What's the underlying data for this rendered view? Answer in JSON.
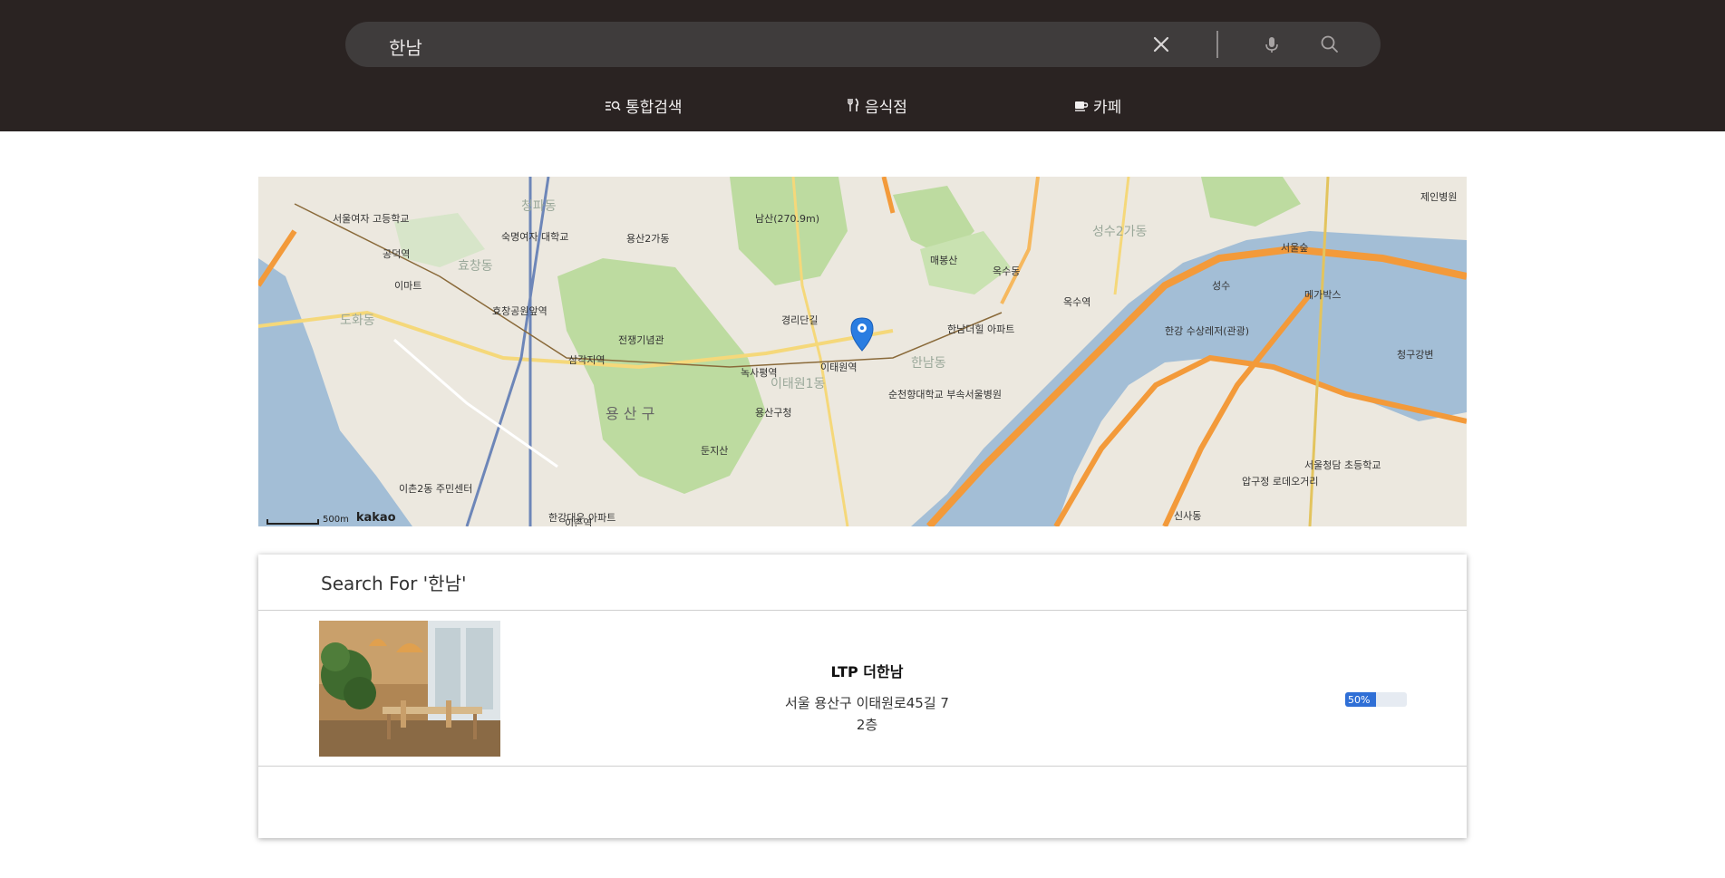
{
  "search": {
    "query": "한남",
    "clear_icon": "close-icon",
    "mic_icon": "microphone-icon",
    "search_icon": "search-icon"
  },
  "nav": {
    "tabs": [
      {
        "label": "통합검색",
        "icon": "search-list-icon"
      },
      {
        "label": "음식점",
        "icon": "fork-knife-icon"
      },
      {
        "label": "카페",
        "icon": "coffee-cup-icon"
      }
    ]
  },
  "map": {
    "district_labels": [
      "용 산 구",
      "용산2가동",
      "한남동",
      "이태원1동",
      "도화동",
      "효창동",
      "청파동",
      "옥수동",
      "성수2가동"
    ],
    "place_labels": [
      "공덕역",
      "이마트",
      "효창공원앞역",
      "삼각지역",
      "녹사평역",
      "이태원역",
      "용산구청",
      "옥수역",
      "서울숲",
      "성수",
      "청구강변",
      "메가박스",
      "순천향대학교 부속서울병원",
      "한남더힐 아파트",
      "경리단길",
      "남산(270.9m)",
      "매봉산",
      "둔지산",
      "서울여자 고등학교",
      "숙명여자 대학교",
      "전쟁기념관",
      "이촌2동 주민센터",
      "한강대우 아파트",
      "이촌역",
      "신사동",
      "압구정 로데오거리",
      "서울청담 초등학교",
      "제인병원",
      "한강 수상레저(관광)"
    ],
    "scale_label": "500m",
    "brand": "kakao",
    "marker_icon": "location-pin-icon"
  },
  "results": {
    "heading": "Search For '한남'",
    "items": [
      {
        "name": "LTP 더한남",
        "address_line1": "서울 용산구 이태원로45길 7",
        "address_line2": "2층",
        "progress_percent": 50,
        "progress_label": "50%"
      }
    ]
  },
  "colors": {
    "header_bg": "#2a2322",
    "search_bg": "#3f3c3c",
    "progress_fill": "#2f6fd6",
    "map_water": "#a3bed6",
    "map_park": "#bddba0",
    "map_road": "#f39a3a"
  }
}
